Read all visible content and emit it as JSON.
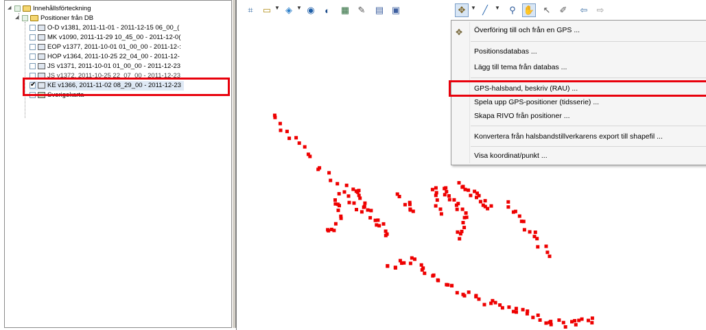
{
  "tree": {
    "root_label": "Innehållsförteckning",
    "group_label": "Positioner från DB",
    "layers": [
      {
        "label": "O-D v1381, 2011-11-01 - 2011-12-15 06_00_(",
        "checked": false
      },
      {
        "label": "MK v1090, 2011-11-29 10_45_00 - 2011-12-0(",
        "checked": false
      },
      {
        "label": "EOP v1377, 2011-10-01 01_00_00 - 2011-12-:",
        "checked": false
      },
      {
        "label": "HOP v1364, 2011-10-25 22_04_00 - 2011-12-",
        "checked": false
      },
      {
        "label": "JS v1371, 2011-10-01 01_00_00 - 2011-12-23",
        "checked": false
      },
      {
        "label": "JS v1372, 2011-10-25 22_07_00 - 2011-12-23",
        "checked": false
      },
      {
        "label": "KE v1366, 2011-11-02 08_29_00 - 2011-12-23",
        "checked": true
      }
    ],
    "basemap_label": "Sverigekarta"
  },
  "toolbar": {
    "icons": [
      "zoom-extent-icon",
      "open-folder-icon",
      "add-layer-icon",
      "globe-icon",
      "half-circle-icon",
      "grid-icon",
      "tools-icon",
      "table-icon",
      "export-icon",
      "gps-tool-icon",
      "draw-line-icon",
      "zoom-icon",
      "pan-icon",
      "select-icon",
      "measure-icon",
      "back-icon",
      "forward-icon"
    ],
    "back_glyph": "⇦",
    "forward_glyph": "⇨"
  },
  "menu": {
    "items": [
      {
        "label": "Överföring till och från en GPS ...",
        "icon": "gps-transfer-icon"
      },
      {
        "label": "Positionsdatabas ..."
      },
      {
        "label": "Lägg till tema från databas ..."
      },
      {
        "label": "GPS-halsband, beskriv (RAU) ..."
      },
      {
        "label": "Spela upp GPS-positioner (tidsserie) ..."
      },
      {
        "label": "Skapa RIVO från positioner ..."
      },
      {
        "label": "Konvertera från halsbandstillverkarens export till shapefil ..."
      },
      {
        "label": "Visa koordinat/punkt ..."
      }
    ]
  },
  "colors": {
    "highlight": "#e8000b",
    "points": "#ee0000"
  }
}
